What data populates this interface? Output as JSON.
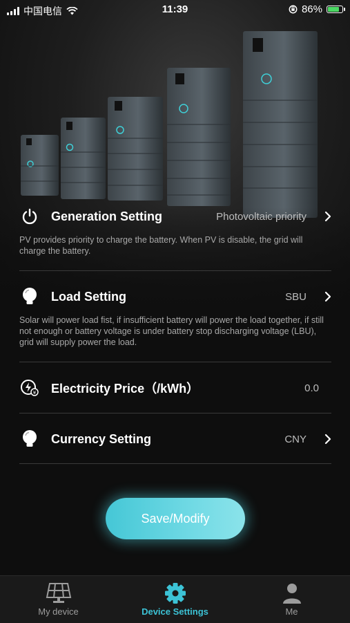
{
  "status_bar": {
    "carrier": "中国电信",
    "time": "11:39",
    "battery_percent": "86%",
    "battery_level": 0.86
  },
  "settings": [
    {
      "title": "Generation Setting",
      "value": "Photovoltaic priority",
      "description": "PV provides priority to charge the battery. When PV is disable, the grid will charge the battery.",
      "icon": "power-icon",
      "has_chevron": true
    },
    {
      "title": "Load Setting",
      "value": "SBU",
      "description": "Solar will power load fist, if insufficient battery will power the load together, if still not enough or battery voltage is under battery stop discharging voltage (LBU), grid will supply power the load.",
      "icon": "bulb-icon",
      "has_chevron": true
    },
    {
      "title": "Electricity Price（/kWh）",
      "value": "0.0",
      "icon": "electricity-price-icon",
      "has_chevron": false
    },
    {
      "title": "Currency Setting",
      "value": "CNY",
      "icon": "bulb-icon",
      "has_chevron": true
    }
  ],
  "save_button": {
    "label": "Save/Modify"
  },
  "tabs": [
    {
      "label": "My device",
      "icon": "solar-panel-icon",
      "active": false
    },
    {
      "label": "Device Settings",
      "icon": "gear-icon",
      "active": true
    },
    {
      "label": "Me",
      "icon": "person-icon",
      "active": false
    }
  ],
  "colors": {
    "accent": "#3cc3d6",
    "background": "#0e0e0e",
    "battery_fill": "#4cd964"
  }
}
